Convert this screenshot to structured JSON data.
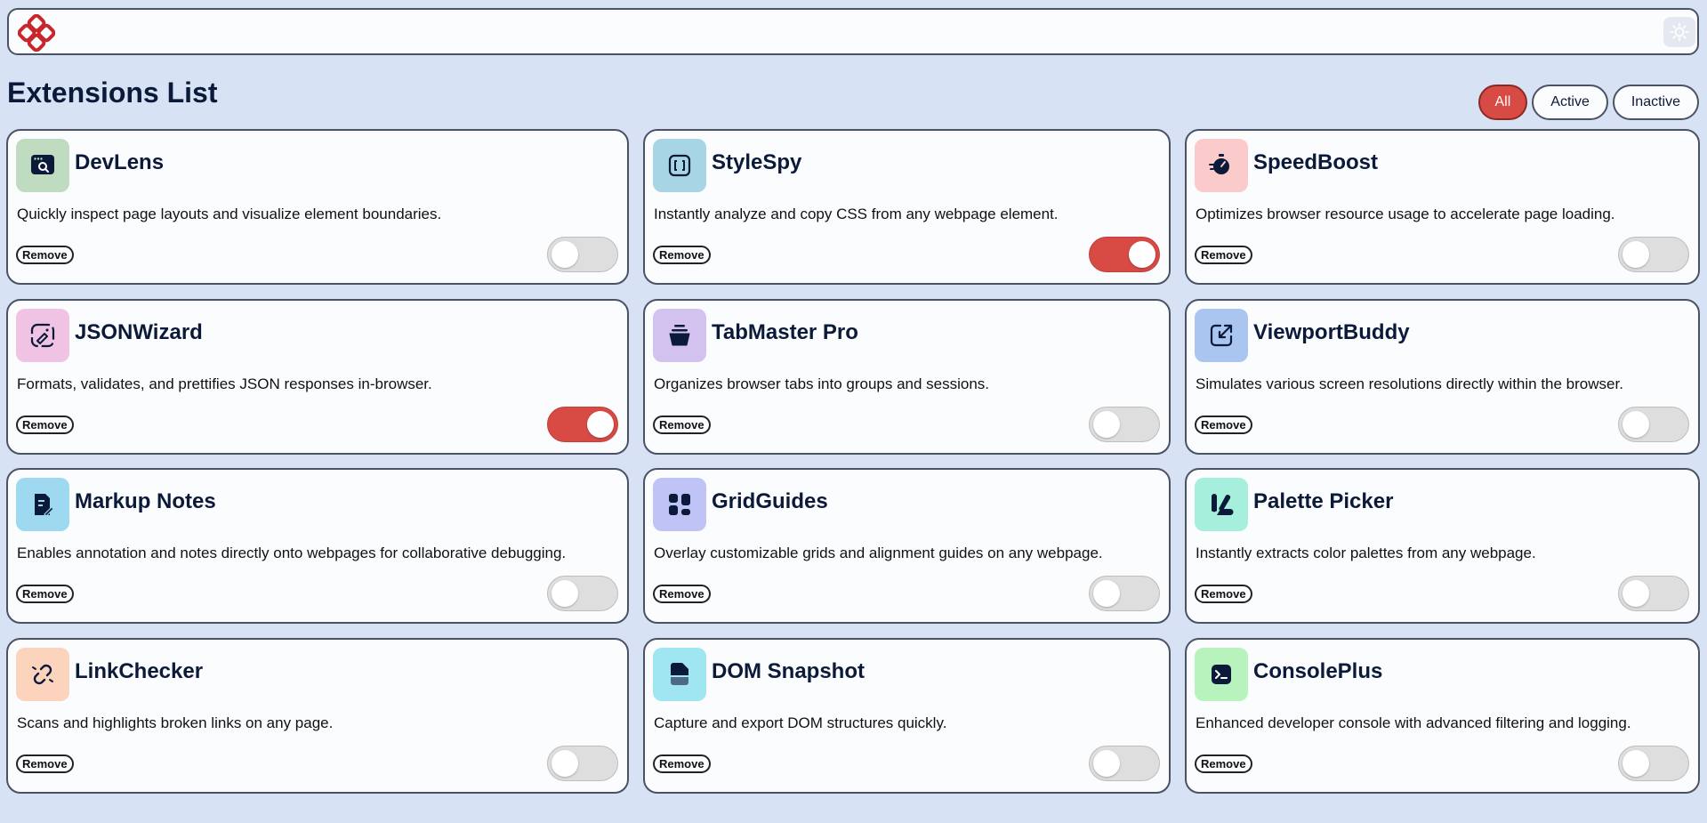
{
  "page_title": "Extensions List",
  "header": {
    "logo_icon": "logo-icon",
    "theme_icon": "sun-icon"
  },
  "filters": {
    "all": "All",
    "active": "Active",
    "inactive": "Inactive",
    "selected": "all"
  },
  "remove_label": "Remove",
  "colors": {
    "accent": "#d84a44",
    "background": "#d7e3f4",
    "text": "#0c1a3a"
  },
  "extensions": [
    {
      "name": "DevLens",
      "description": "Quickly inspect page layouts and visualize element boundaries.",
      "active": false,
      "icon": "devlens-icon",
      "icon_bg": "#bfdcc0"
    },
    {
      "name": "StyleSpy",
      "description": "Instantly analyze and copy CSS from any webpage element.",
      "active": true,
      "icon": "stylespy-icon",
      "icon_bg": "#a7d5e6"
    },
    {
      "name": "SpeedBoost",
      "description": "Optimizes browser resource usage to accelerate page loading.",
      "active": false,
      "icon": "speedboost-icon",
      "icon_bg": "#fbcaca"
    },
    {
      "name": "JSONWizard",
      "description": "Formats, validates, and prettifies JSON responses in-browser.",
      "active": true,
      "icon": "jsonwizard-icon",
      "icon_bg": "#f0c2e4"
    },
    {
      "name": "TabMaster Pro",
      "description": "Organizes browser tabs into groups and sessions.",
      "active": false,
      "icon": "tabmaster-icon",
      "icon_bg": "#d3c2f0"
    },
    {
      "name": "ViewportBuddy",
      "description": "Simulates various screen resolutions directly within the browser.",
      "active": false,
      "icon": "viewportbuddy-icon",
      "icon_bg": "#a9c5f0"
    },
    {
      "name": "Markup Notes",
      "description": "Enables annotation and notes directly onto webpages for collaborative debugging.",
      "active": false,
      "icon": "markupnotes-icon",
      "icon_bg": "#9ed9f1"
    },
    {
      "name": "GridGuides",
      "description": "Overlay customizable grids and alignment guides on any webpage.",
      "active": false,
      "icon": "gridguides-icon",
      "icon_bg": "#c0c3f5"
    },
    {
      "name": "Palette Picker",
      "description": "Instantly extracts color palettes from any webpage.",
      "active": false,
      "icon": "palettepicker-icon",
      "icon_bg": "#a5efdc"
    },
    {
      "name": "LinkChecker",
      "description": "Scans and highlights broken links on any page.",
      "active": false,
      "icon": "linkchecker-icon",
      "icon_bg": "#fcd3bd"
    },
    {
      "name": "DOM Snapshot",
      "description": "Capture and export DOM structures quickly.",
      "active": false,
      "icon": "domsnapshot-icon",
      "icon_bg": "#9fe6f0"
    },
    {
      "name": "ConsolePlus",
      "description": "Enhanced developer console with advanced filtering and logging.",
      "active": false,
      "icon": "consoleplus-icon",
      "icon_bg": "#b8f2bc"
    }
  ]
}
